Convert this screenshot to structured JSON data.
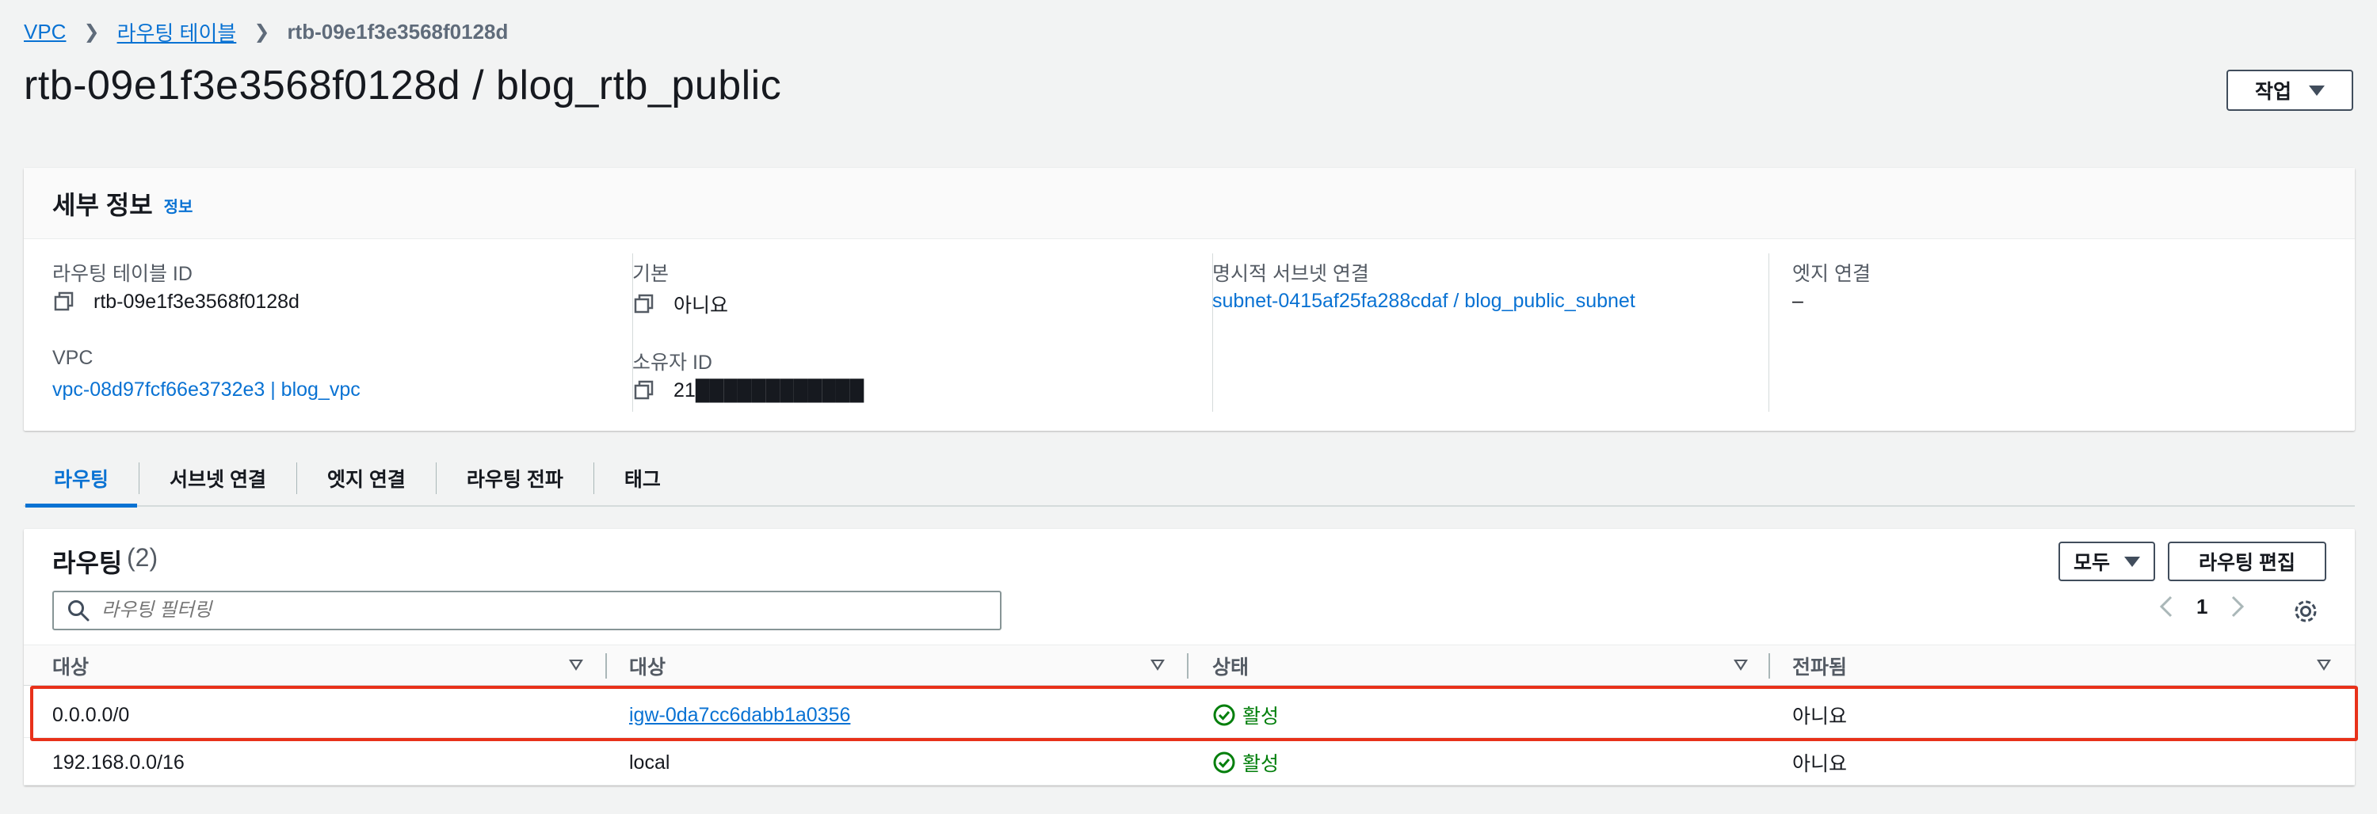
{
  "breadcrumb": {
    "items": [
      "VPC",
      "라우팅 테이블"
    ],
    "current": "rtb-09e1f3e3568f0128d"
  },
  "page": {
    "title": "rtb-09e1f3e3568f0128d / blog_rtb_public",
    "actions_label": "작업"
  },
  "details": {
    "title": "세부 정보",
    "info_label": "정보",
    "route_table_id_label": "라우팅 테이블 ID",
    "route_table_id": "rtb-09e1f3e3568f0128d",
    "vpc_label": "VPC",
    "vpc_value": "vpc-08d97fcf66e3732e3 | blog_vpc",
    "main_label": "기본",
    "main_value": "아니요",
    "owner_label": "소유자 ID",
    "owner_value": "21████████████",
    "subnet_assoc_label": "명시적 서브넷 연결",
    "subnet_assoc_value": "subnet-0415af25fa288cdaf / blog_public_subnet",
    "edge_assoc_label": "엣지 연결",
    "edge_assoc_value": "–"
  },
  "tabs": [
    {
      "label": "라우팅",
      "active": true
    },
    {
      "label": "서브넷 연결",
      "active": false
    },
    {
      "label": "엣지 연결",
      "active": false
    },
    {
      "label": "라우팅 전파",
      "active": false
    },
    {
      "label": "태그",
      "active": false
    }
  ],
  "routes": {
    "title": "라우팅",
    "count": "(2)",
    "filter_placeholder": "라우팅 필터링",
    "all_label": "모두",
    "edit_label": "라우팅 편집",
    "page_number": "1",
    "columns": [
      "대상",
      "대상",
      "상태",
      "전파됨"
    ],
    "rows": [
      {
        "destination": "0.0.0.0/0",
        "target": "igw-0da7cc6dabb1a0356",
        "target_is_link": true,
        "status": "활성",
        "propagated": "아니요",
        "highlighted": true
      },
      {
        "destination": "192.168.0.0/16",
        "target": "local",
        "target_is_link": false,
        "status": "활성",
        "propagated": "아니요",
        "highlighted": false
      }
    ]
  },
  "colors": {
    "link": "#0972d3",
    "success": "#037f0c",
    "highlight": "#e8311a"
  }
}
